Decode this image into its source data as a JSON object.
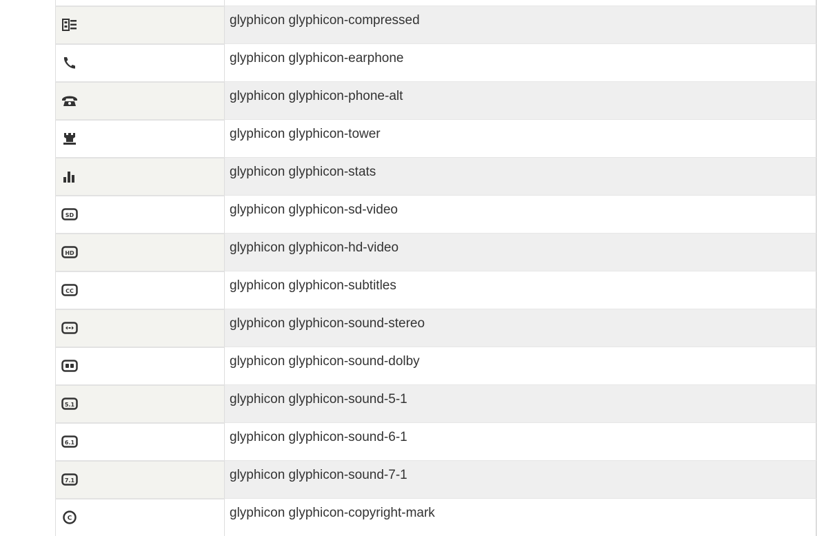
{
  "table": {
    "rows": [
      {
        "icon": "blank-icon",
        "label": ""
      },
      {
        "icon": "compressed-icon",
        "label": "glyphicon glyphicon-compressed"
      },
      {
        "icon": "earphone-icon",
        "label": "glyphicon glyphicon-earphone"
      },
      {
        "icon": "phone-alt-icon",
        "label": "glyphicon glyphicon-phone-alt"
      },
      {
        "icon": "tower-icon",
        "label": "glyphicon glyphicon-tower"
      },
      {
        "icon": "stats-icon",
        "label": "glyphicon glyphicon-stats"
      },
      {
        "icon": "sd-video-icon",
        "label": "glyphicon glyphicon-sd-video"
      },
      {
        "icon": "hd-video-icon",
        "label": "glyphicon glyphicon-hd-video"
      },
      {
        "icon": "subtitles-icon",
        "label": "glyphicon glyphicon-subtitles"
      },
      {
        "icon": "sound-stereo-icon",
        "label": "glyphicon glyphicon-sound-stereo"
      },
      {
        "icon": "sound-dolby-icon",
        "label": "glyphicon glyphicon-sound-dolby"
      },
      {
        "icon": "sound-5-1-icon",
        "label": "glyphicon glyphicon-sound-5-1"
      },
      {
        "icon": "sound-6-1-icon",
        "label": "glyphicon glyphicon-sound-6-1"
      },
      {
        "icon": "sound-7-1-icon",
        "label": "glyphicon glyphicon-sound-7-1"
      },
      {
        "icon": "copyright-mark-icon",
        "label": "glyphicon glyphicon-copyright-mark"
      }
    ]
  },
  "icon_text": {
    "sd": "SD",
    "hd": "HD",
    "cc": "CC",
    "s51": "5.1",
    "s61": "6.1",
    "s71": "7.1",
    "copyright": "C"
  }
}
